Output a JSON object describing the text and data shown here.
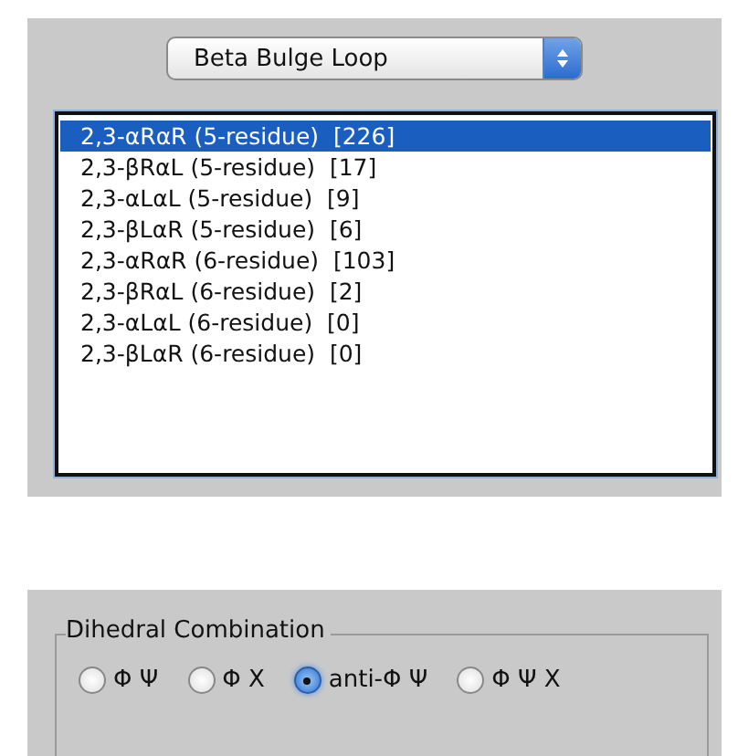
{
  "dropdown": {
    "value": "Beta Bulge Loop"
  },
  "list": [
    {
      "label": "2,3-αRαR (5-residue)  [226]",
      "selected": true
    },
    {
      "label": "2,3-βRαL (5-residue)  [17]",
      "selected": false
    },
    {
      "label": "2,3-αLαL (5-residue)  [9]",
      "selected": false
    },
    {
      "label": "2,3-βLαR (5-residue)  [6]",
      "selected": false
    },
    {
      "label": "2,3-αRαR (6-residue)  [103]",
      "selected": false
    },
    {
      "label": "2,3-βRαL (6-residue)  [2]",
      "selected": false
    },
    {
      "label": "2,3-αLαL (6-residue)  [0]",
      "selected": false
    },
    {
      "label": "2,3-βLαR (6-residue)  [0]",
      "selected": false
    }
  ],
  "dihedral_combination": {
    "title": "Dihedral Combination",
    "options": [
      {
        "label": "Φ Ψ",
        "selected": false
      },
      {
        "label": "Φ X",
        "selected": false
      },
      {
        "label": "anti-Φ Ψ",
        "selected": true
      },
      {
        "label": "Φ Ψ X",
        "selected": false
      }
    ]
  }
}
